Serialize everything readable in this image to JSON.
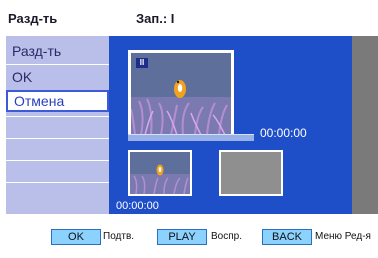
{
  "header": {
    "title": "Разд-ть",
    "info": "Зап.: I"
  },
  "sidebar": {
    "items": [
      {
        "label": "Разд-ть"
      },
      {
        "label": "OK"
      },
      {
        "label": "Отмена"
      }
    ]
  },
  "preview": {
    "badge": "II",
    "progress": 0,
    "time": "00:00:00"
  },
  "thumbnail": {
    "time": "00:00:00"
  },
  "footer": {
    "buttons": [
      {
        "key": "OK",
        "desc": "Подтв."
      },
      {
        "key": "PLAY",
        "desc": "Воспр."
      },
      {
        "key": "BACK",
        "desc": "Меню Ред-я"
      }
    ]
  },
  "colors": {
    "sidebar": "#b9bfe8",
    "main_panel": "#1f4ec9",
    "selection_border": "#3d5bd8",
    "key_button": "#8cd2ff"
  }
}
